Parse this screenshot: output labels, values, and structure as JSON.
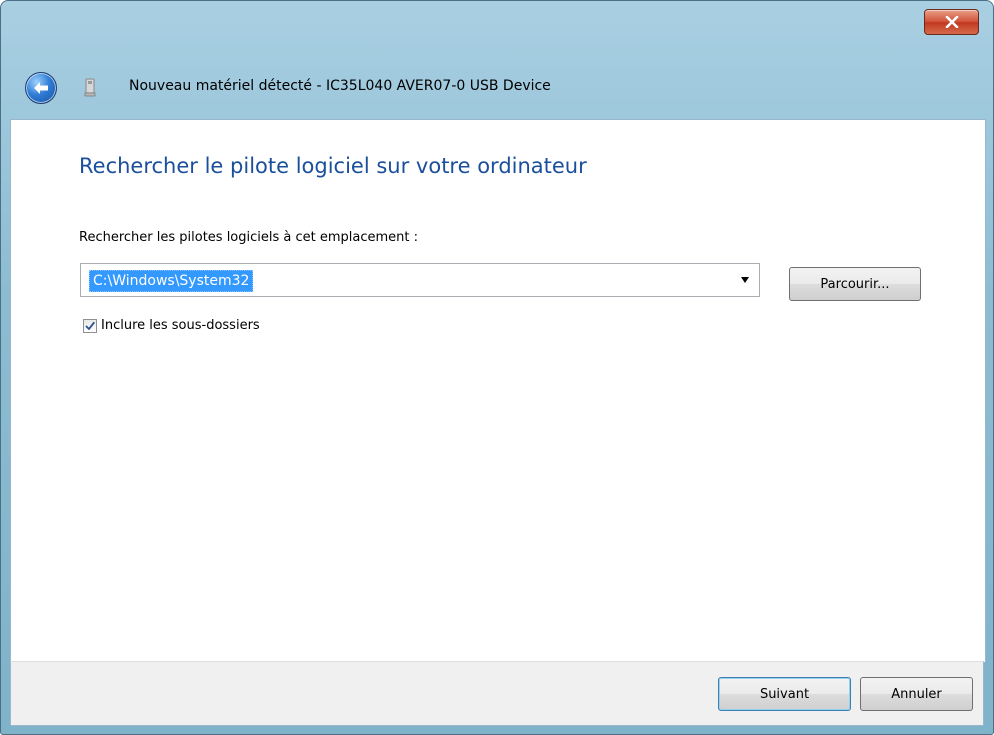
{
  "window": {
    "caption": "Nouveau matériel détecté - IC35L040 AVER07-0 USB Device",
    "background_title": "",
    "close_icon": "close-icon",
    "back_icon": "back-arrow-icon",
    "device_icon": "usb-device-icon"
  },
  "content": {
    "heading": "Rechercher le pilote logiciel sur votre ordinateur",
    "location_label": "Rechercher les pilotes logiciels à cet emplacement :",
    "path_value": "C:\\Windows\\System32",
    "browse_label": "Parcourir...",
    "include_subfolders": {
      "label": "Inclure les sous-dossiers",
      "checked": true
    }
  },
  "footer": {
    "next_label": "Suivant",
    "cancel_label": "Annuler"
  },
  "colors": {
    "heading": "#1b4f9c",
    "selection": "#3399ff",
    "frame": "#8cbcd2"
  }
}
